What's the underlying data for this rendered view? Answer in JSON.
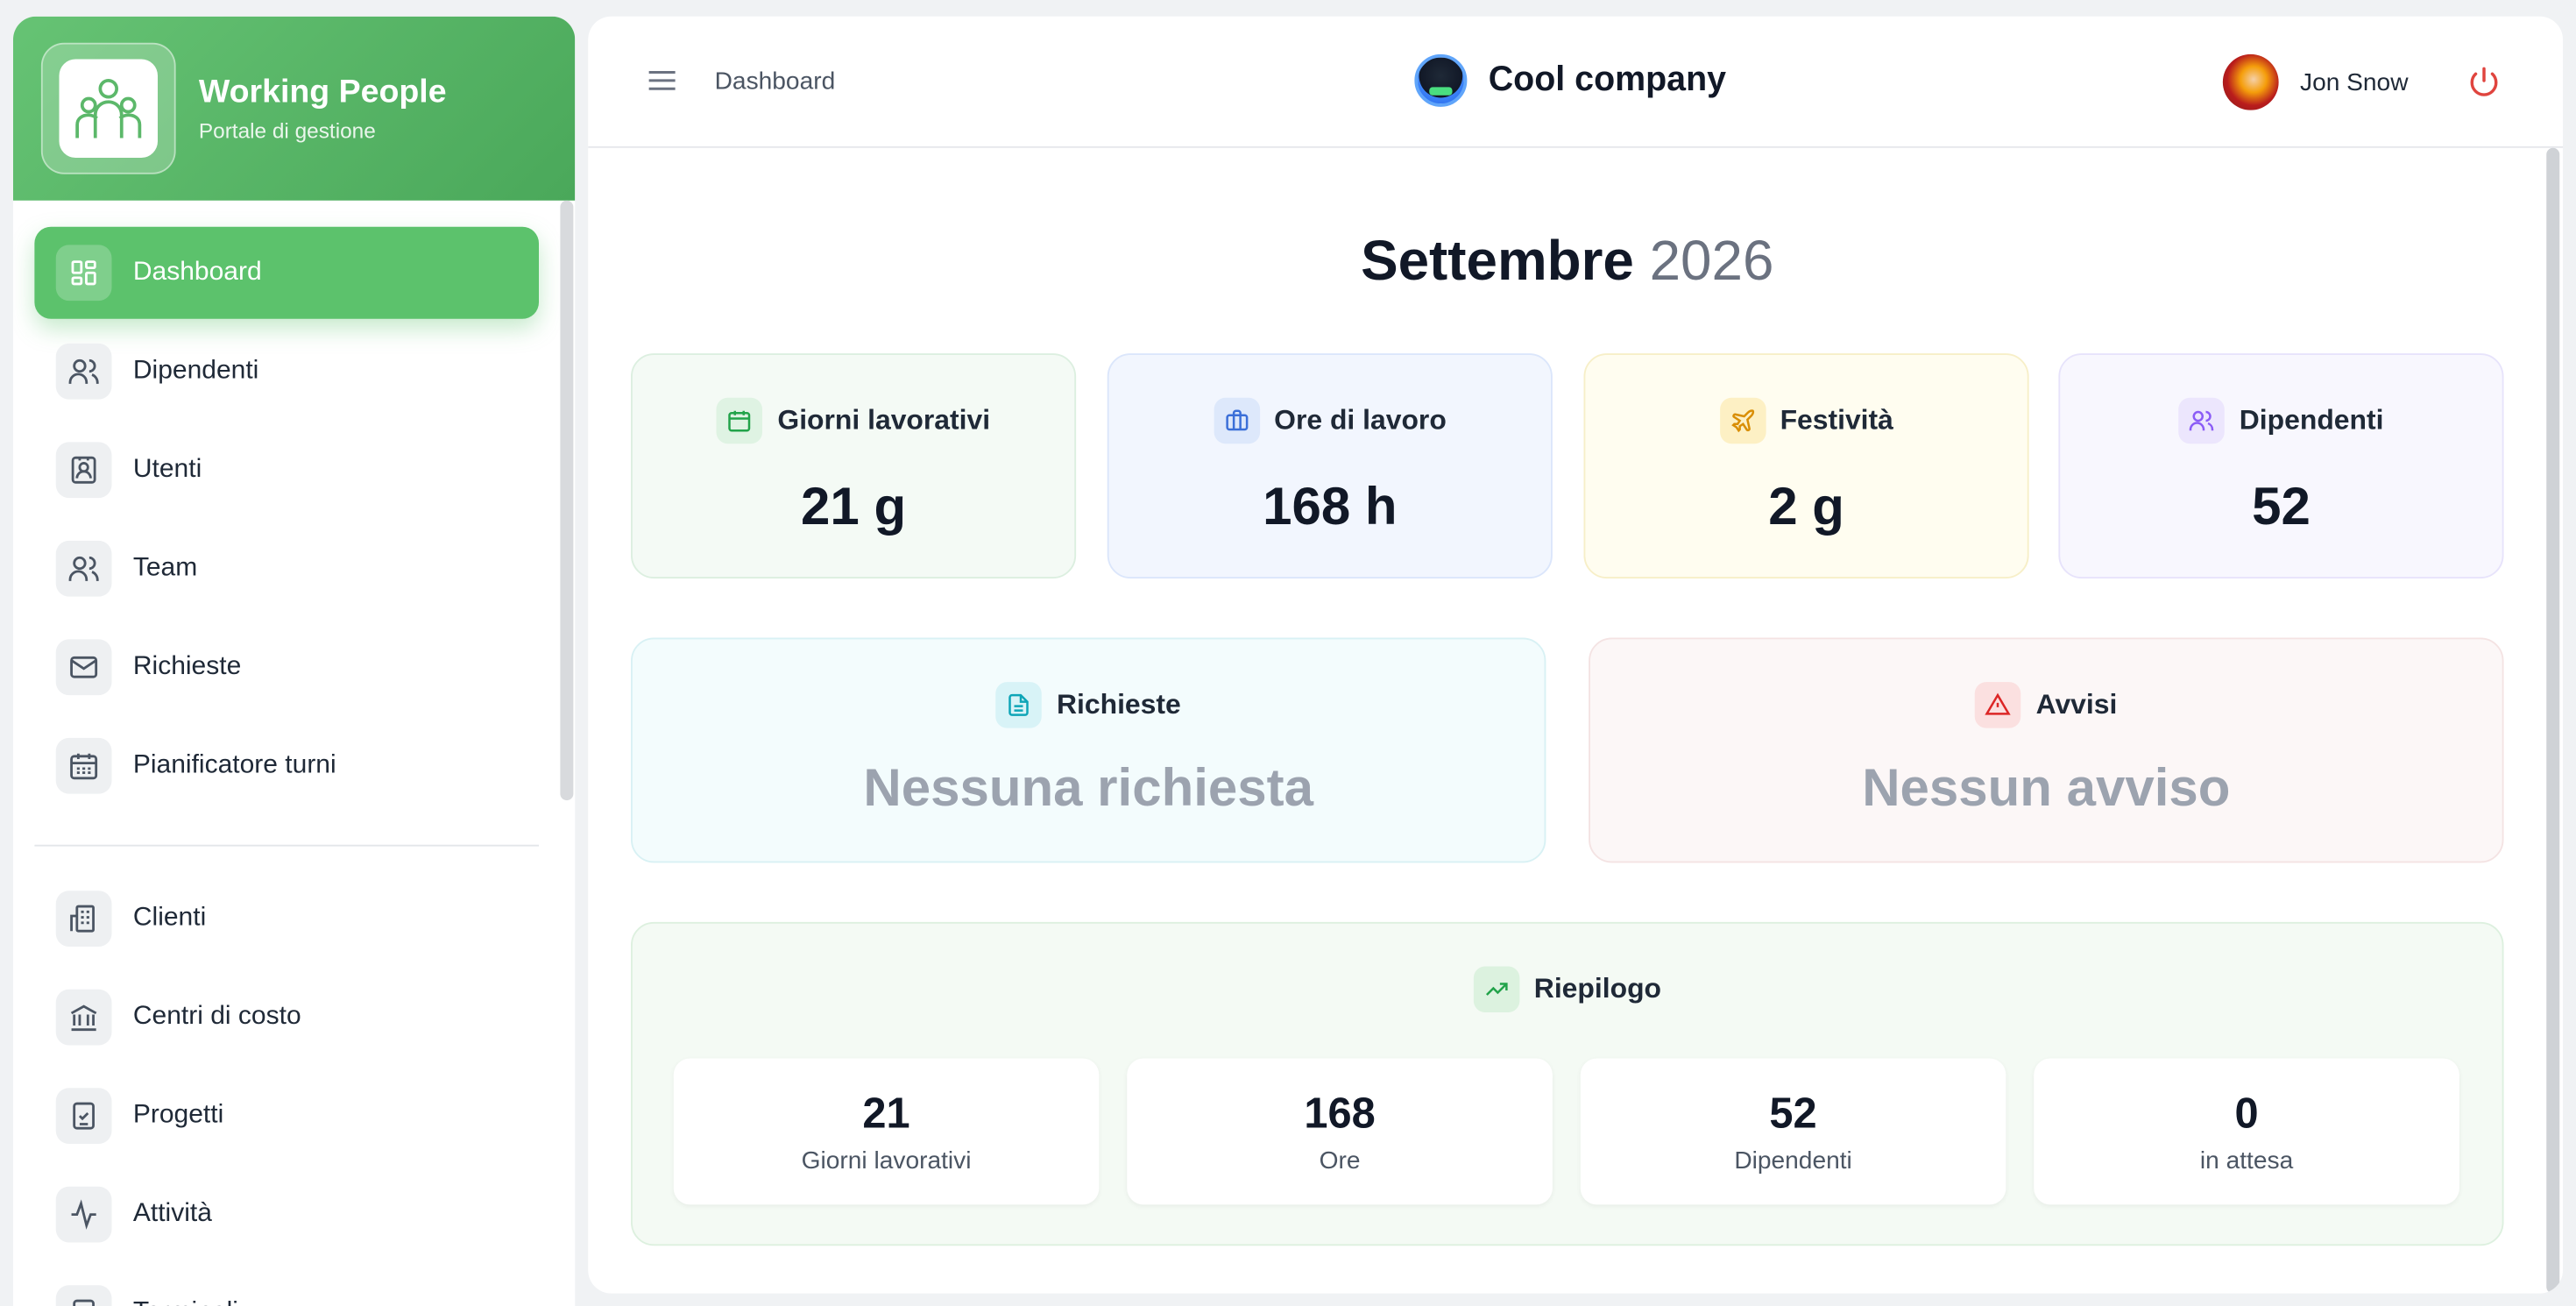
{
  "brand": {
    "title": "Working People",
    "subtitle": "Portale di gestione"
  },
  "sidebar": {
    "items": [
      {
        "label": "Dipendenti"
      },
      {
        "label": "Utenti"
      },
      {
        "label": "Team"
      },
      {
        "label": "Richieste"
      },
      {
        "label": "Pianificatore turni"
      },
      {
        "label": "Clienti"
      },
      {
        "label": "Centri di costo"
      },
      {
        "label": "Progetti"
      },
      {
        "label": "Attività"
      },
      {
        "label": "Terminali"
      }
    ],
    "active": {
      "label": "Dashboard"
    }
  },
  "header": {
    "breadcrumb": "Dashboard",
    "company": "Cool company",
    "user": "Jon Snow"
  },
  "period": {
    "month": "Settembre",
    "year": "2026"
  },
  "stats": [
    {
      "label": "Giorni lavorativi",
      "value": "21 g",
      "color": "#22a34a"
    },
    {
      "label": "Ore di lavoro",
      "value": "168 h",
      "color": "#3b6fd8"
    },
    {
      "label": "Festività",
      "value": "2 g",
      "color": "#d98e05"
    },
    {
      "label": "Dipendenti",
      "value": "52",
      "color": "#8b5cf6"
    }
  ],
  "panels": {
    "requests": {
      "title": "Richieste",
      "empty": "Nessuna richiesta"
    },
    "alerts": {
      "title": "Avvisi",
      "empty": "Nessun avviso"
    }
  },
  "summary": {
    "title": "Riepilogo",
    "cards": [
      {
        "value": "21",
        "label": "Giorni lavorativi"
      },
      {
        "value": "168",
        "label": "Ore"
      },
      {
        "value": "52",
        "label": "Dipendenti"
      },
      {
        "value": "0",
        "label": "in attesa"
      }
    ]
  },
  "icons": {
    "nav": [
      "dashboard-icon",
      "users-icon",
      "contact-card-icon",
      "team-icon",
      "mail-icon",
      "calendar-icon",
      "building-icon",
      "bank-icon",
      "clipboard-check-icon",
      "activity-icon",
      "terminal-icon"
    ]
  }
}
